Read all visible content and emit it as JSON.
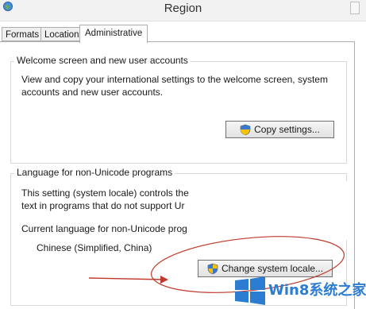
{
  "window": {
    "title": "Region"
  },
  "tabs": [
    {
      "label": "Formats",
      "active": false
    },
    {
      "label": "Location",
      "active": false
    },
    {
      "label": "Administrative",
      "active": true
    }
  ],
  "welcome": {
    "legend": "Welcome screen and new user accounts",
    "line1": "View and copy your international settings to the welcome screen, system",
    "line2": "accounts and new user accounts.",
    "button_label": "Copy settings..."
  },
  "non_unicode": {
    "legend": "Language for non-Unicode programs",
    "line1": "This setting (system locale) controls the",
    "line2": "text in programs that do not support Ur",
    "current_label": "Current language for non-Unicode prog",
    "current_value": "Chinese (Simplified, China)",
    "button_label": "Change system locale..."
  },
  "watermark": {
    "text": "Win8系统之家",
    "color": "#2c7cd1"
  },
  "annotation_color": "#c0392b",
  "icons": {
    "app": "globe-icon",
    "button": "uac-shield-icon"
  }
}
